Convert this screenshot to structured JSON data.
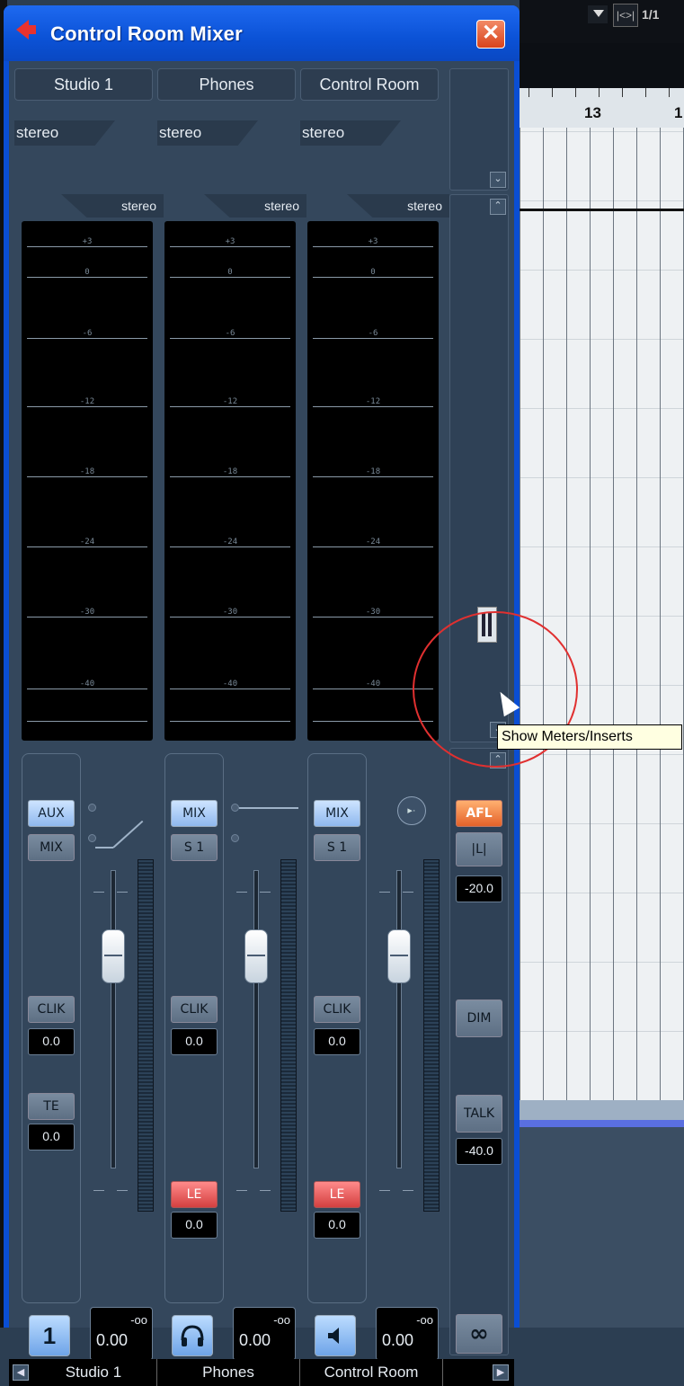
{
  "window": {
    "title": "Control Room Mixer"
  },
  "background": {
    "ruler_number": "13",
    "ruler_number_partial": "1",
    "top_icon": "|<>|",
    "top_text": "1/1"
  },
  "channels": [
    {
      "name": "Studio 1",
      "format": "stereo",
      "meter_format": "stereo",
      "route_top": "AUX",
      "route_bottom": "MIX",
      "clik": "CLIK",
      "clik_val": "0.0",
      "te": "TE",
      "te_val": "0.0",
      "icon_label": "1",
      "vol_inf": "-oo",
      "vol": "0.00"
    },
    {
      "name": "Phones",
      "format": "stereo",
      "meter_format": "stereo",
      "route_top": "MIX",
      "route_bottom": "S 1",
      "clik": "CLIK",
      "clik_val": "0.0",
      "le": "LE",
      "le_val": "0.0",
      "vol_inf": "-oo",
      "vol": "0.00"
    },
    {
      "name": "Control Room",
      "format": "stereo",
      "meter_format": "stereo",
      "route_top": "MIX",
      "route_bottom": "S 1",
      "clik": "CLIK",
      "clik_val": "0.0",
      "le": "LE",
      "le_val": "0.0",
      "vol_inf": "-oo",
      "vol": "0.00"
    }
  ],
  "meter_scale": [
    "+3",
    "0",
    "-6",
    "-12",
    "-18",
    "-24",
    "-30",
    "-40"
  ],
  "master": {
    "afl": "AFL",
    "mono": "|L|",
    "afl_val": "-20.0",
    "dim": "DIM",
    "talk": "TALK",
    "talk_val": "-40.0",
    "link_icon": "∞"
  },
  "tooltip": "Show Meters/Inserts",
  "colors": {
    "title_bar": "#0b52d6",
    "panel": "#34475c",
    "accent_blue": "#8fb8ee",
    "accent_red": "#d44040",
    "accent_orange": "#e4622a"
  }
}
